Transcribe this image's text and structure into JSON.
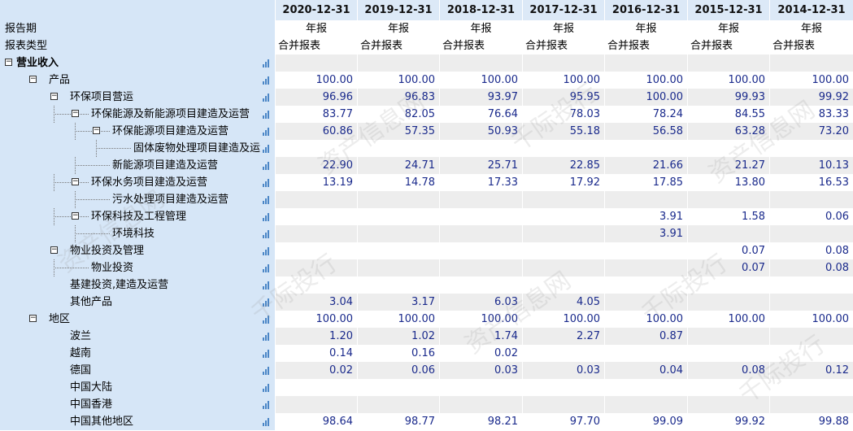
{
  "columns": [
    "2020-12-31",
    "2019-12-31",
    "2018-12-31",
    "2017-12-31",
    "2016-12-31",
    "2015-12-31",
    "2014-12-31"
  ],
  "report_period": {
    "label": "报告期",
    "values": [
      "年报",
      "年报",
      "年报",
      "年报",
      "年报",
      "年报",
      "年报"
    ]
  },
  "report_type": {
    "label": "报表类型",
    "values": [
      "合并报表",
      "合并报表",
      "合并报表",
      "合并报表",
      "合并报表",
      "合并报表",
      "合并报表"
    ]
  },
  "rows": [
    {
      "label": "营业收入",
      "level": 0,
      "toggle": true,
      "bold": true,
      "values": [
        "",
        "",
        "",
        "",
        "",
        "",
        ""
      ]
    },
    {
      "label": "产品",
      "level": 1,
      "toggle": true,
      "values": [
        "100.00",
        "100.00",
        "100.00",
        "100.00",
        "100.00",
        "100.00",
        "100.00"
      ]
    },
    {
      "label": "环保项目营运",
      "level": 2,
      "toggle": true,
      "values": [
        "96.96",
        "96.83",
        "93.97",
        "95.95",
        "100.00",
        "99.93",
        "99.92"
      ]
    },
    {
      "label": "环保能源及新能源项目建造及运营",
      "level": 3,
      "toggle": true,
      "values": [
        "83.77",
        "82.05",
        "76.64",
        "78.03",
        "78.24",
        "84.55",
        "83.33"
      ]
    },
    {
      "label": "环保能源项目建造及运营",
      "level": 4,
      "toggle": true,
      "values": [
        "60.86",
        "57.35",
        "50.93",
        "55.18",
        "56.58",
        "63.28",
        "73.20"
      ]
    },
    {
      "label": "固体废物处理项目建造及运",
      "level": 5,
      "toggle": false,
      "values": [
        "",
        "",
        "",
        "",
        "",
        "",
        ""
      ]
    },
    {
      "label": "新能源项目建造及运营",
      "level": 4,
      "toggle": false,
      "values": [
        "22.90",
        "24.71",
        "25.71",
        "22.85",
        "21.66",
        "21.27",
        "10.13"
      ]
    },
    {
      "label": "环保水务项目建造及运营",
      "level": 3,
      "toggle": true,
      "values": [
        "13.19",
        "14.78",
        "17.33",
        "17.92",
        "17.85",
        "13.80",
        "16.53"
      ]
    },
    {
      "label": "污水处理项目建造及运营",
      "level": 4,
      "toggle": false,
      "values": [
        "",
        "",
        "",
        "",
        "",
        "",
        ""
      ]
    },
    {
      "label": "环保科技及工程管理",
      "level": 3,
      "toggle": true,
      "values": [
        "",
        "",
        "",
        "",
        "3.91",
        "1.58",
        "0.06"
      ]
    },
    {
      "label": "环境科技",
      "level": 4,
      "toggle": false,
      "values": [
        "",
        "",
        "",
        "",
        "3.91",
        "",
        ""
      ]
    },
    {
      "label": "物业投资及管理",
      "level": 2,
      "toggle": true,
      "values": [
        "",
        "",
        "",
        "",
        "",
        "0.07",
        "0.08"
      ]
    },
    {
      "label": "物业投资",
      "level": 3,
      "toggle": false,
      "values": [
        "",
        "",
        "",
        "",
        "",
        "0.07",
        "0.08"
      ]
    },
    {
      "label": "基建投资,建造及运营",
      "level": 2,
      "toggle": false,
      "values": [
        "",
        "",
        "",
        "",
        "",
        "",
        ""
      ]
    },
    {
      "label": "其他产品",
      "level": 2,
      "toggle": false,
      "values": [
        "3.04",
        "3.17",
        "6.03",
        "4.05",
        "",
        "",
        ""
      ]
    },
    {
      "label": "地区",
      "level": 1,
      "toggle": true,
      "values": [
        "100.00",
        "100.00",
        "100.00",
        "100.00",
        "100.00",
        "100.00",
        "100.00"
      ]
    },
    {
      "label": "波兰",
      "level": 2,
      "toggle": false,
      "values": [
        "1.20",
        "1.02",
        "1.74",
        "2.27",
        "0.87",
        "",
        ""
      ]
    },
    {
      "label": "越南",
      "level": 2,
      "toggle": false,
      "values": [
        "0.14",
        "0.16",
        "0.02",
        "",
        "",
        "",
        ""
      ]
    },
    {
      "label": "德国",
      "level": 2,
      "toggle": false,
      "values": [
        "0.02",
        "0.06",
        "0.03",
        "0.03",
        "0.04",
        "0.08",
        "0.12"
      ]
    },
    {
      "label": "中国大陆",
      "level": 2,
      "toggle": false,
      "values": [
        "",
        "",
        "",
        "",
        "",
        "",
        ""
      ]
    },
    {
      "label": "中国香港",
      "level": 2,
      "toggle": false,
      "values": [
        "",
        "",
        "",
        "",
        "",
        "",
        ""
      ]
    },
    {
      "label": "中国其他地区",
      "level": 2,
      "toggle": false,
      "values": [
        "98.64",
        "98.77",
        "98.21",
        "97.70",
        "99.09",
        "99.92",
        "99.88"
      ]
    }
  ],
  "watermark": [
    "资产信息网",
    "千际投行",
    "资产信息网",
    "千际投行"
  ],
  "colors": {
    "header_bg": "#dce9f7",
    "label_bg": "#d6e6f7",
    "alt_row": "#ededed",
    "value_text": "#1a2a8c",
    "bar_icon": "#4b86c6"
  },
  "icons": {
    "row_chart": "bar-chart-icon",
    "expand_toggle": "collapse-minus-icon"
  }
}
